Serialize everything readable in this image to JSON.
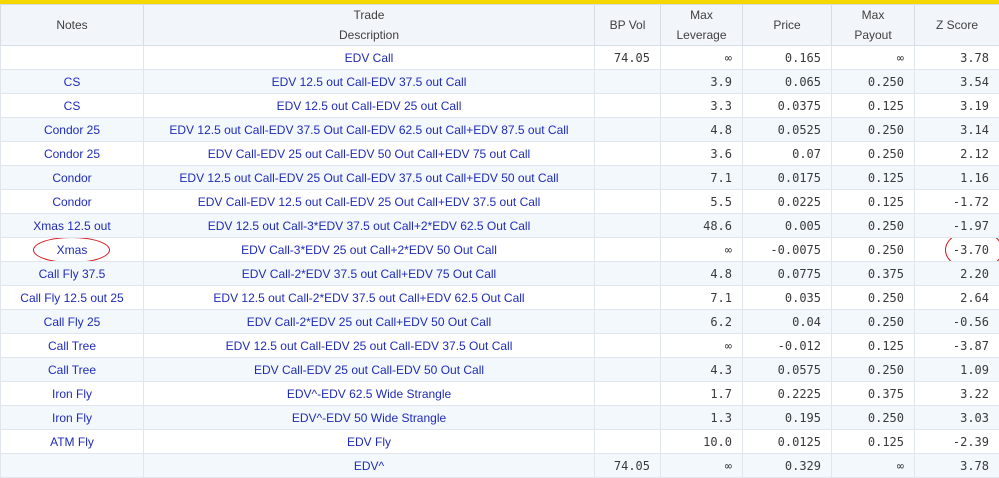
{
  "accent_color": "#f5d800",
  "annotation_color": "#d9141b",
  "headers": [
    {
      "label": "Notes",
      "align": "txt"
    },
    {
      "label": "Trade\nDescription",
      "align": "txt"
    },
    {
      "label": "BP Vol",
      "align": "num"
    },
    {
      "label": "Max\nLeverage",
      "align": "num"
    },
    {
      "label": "Price",
      "align": "num"
    },
    {
      "label": "Max\nPayout",
      "align": "num"
    },
    {
      "label": "Z Score",
      "align": "num"
    }
  ],
  "rows": [
    {
      "notes": "",
      "desc": "EDV Call",
      "bpvol": "74.05",
      "lev": "∞",
      "price": "0.165",
      "payout": "∞",
      "z": "3.78"
    },
    {
      "notes": "CS",
      "desc": "EDV 12.5 out Call-EDV 37.5 out Call",
      "bpvol": "",
      "lev": "3.9",
      "price": "0.065",
      "payout": "0.250",
      "z": "3.54"
    },
    {
      "notes": "CS",
      "desc": "EDV 12.5 out Call-EDV 25 out Call",
      "bpvol": "",
      "lev": "3.3",
      "price": "0.0375",
      "payout": "0.125",
      "z": "3.19"
    },
    {
      "notes": "Condor 25",
      "desc": "EDV 12.5 out Call-EDV 37.5 Out Call-EDV 62.5 out Call+EDV 87.5 out Call",
      "bpvol": "",
      "lev": "4.8",
      "price": "0.0525",
      "payout": "0.250",
      "z": "3.14"
    },
    {
      "notes": "Condor 25",
      "desc": "EDV Call-EDV 25 out Call-EDV 50 Out Call+EDV 75 out Call",
      "bpvol": "",
      "lev": "3.6",
      "price": "0.07",
      "payout": "0.250",
      "z": "2.12"
    },
    {
      "notes": "Condor",
      "desc": "EDV 12.5 out Call-EDV 25 Out Call-EDV 37.5 out Call+EDV 50 out Call",
      "bpvol": "",
      "lev": "7.1",
      "price": "0.0175",
      "payout": "0.125",
      "z": "1.16"
    },
    {
      "notes": "Condor",
      "desc": "EDV Call-EDV 12.5 out Call-EDV 25 Out Call+EDV 37.5 out Call",
      "bpvol": "",
      "lev": "5.5",
      "price": "0.0225",
      "payout": "0.125",
      "z": "-1.72"
    },
    {
      "notes": "Xmas 12.5 out",
      "desc": "EDV 12.5 out Call-3*EDV 37.5 out Call+2*EDV 62.5 Out Call",
      "bpvol": "",
      "lev": "48.6",
      "price": "0.005",
      "payout": "0.250",
      "z": "-1.97"
    },
    {
      "notes": "Xmas",
      "desc": "EDV Call-3*EDV 25 out Call+2*EDV 50 Out Call",
      "bpvol": "",
      "lev": "∞",
      "price": "-0.0075",
      "payout": "0.250",
      "z": "-3.70",
      "circled": true
    },
    {
      "notes": "Call Fly 37.5",
      "desc": "EDV Call-2*EDV 37.5 out Call+EDV 75 Out Call",
      "bpvol": "",
      "lev": "4.8",
      "price": "0.0775",
      "payout": "0.375",
      "z": "2.20"
    },
    {
      "notes": "Call Fly 12.5 out 25",
      "desc": "EDV 12.5 out Call-2*EDV 37.5 out Call+EDV 62.5 Out Call",
      "bpvol": "",
      "lev": "7.1",
      "price": "0.035",
      "payout": "0.250",
      "z": "2.64"
    },
    {
      "notes": "Call Fly 25",
      "desc": "EDV Call-2*EDV 25 out Call+EDV 50 Out Call",
      "bpvol": "",
      "lev": "6.2",
      "price": "0.04",
      "payout": "0.250",
      "z": "-0.56"
    },
    {
      "notes": "Call Tree",
      "desc": "EDV 12.5 out Call-EDV 25 out Call-EDV 37.5 Out Call",
      "bpvol": "",
      "lev": "∞",
      "price": "-0.012",
      "payout": "0.125",
      "z": "-3.87"
    },
    {
      "notes": "Call Tree",
      "desc": "EDV Call-EDV 25 out Call-EDV 50 Out Call",
      "bpvol": "",
      "lev": "4.3",
      "price": "0.0575",
      "payout": "0.250",
      "z": "1.09"
    },
    {
      "notes": "Iron Fly",
      "desc": "EDV^-EDV 62.5 Wide Strangle",
      "bpvol": "",
      "lev": "1.7",
      "price": "0.2225",
      "payout": "0.375",
      "z": "3.22"
    },
    {
      "notes": "Iron Fly",
      "desc": "EDV^-EDV 50 Wide Strangle",
      "bpvol": "",
      "lev": "1.3",
      "price": "0.195",
      "payout": "0.250",
      "z": "3.03"
    },
    {
      "notes": "ATM Fly",
      "desc": "EDV Fly",
      "bpvol": "",
      "lev": "10.0",
      "price": "0.0125",
      "payout": "0.125",
      "z": "-2.39"
    },
    {
      "notes": "",
      "desc": "EDV^",
      "bpvol": "74.05",
      "lev": "∞",
      "price": "0.329",
      "payout": "∞",
      "z": "3.78"
    }
  ]
}
